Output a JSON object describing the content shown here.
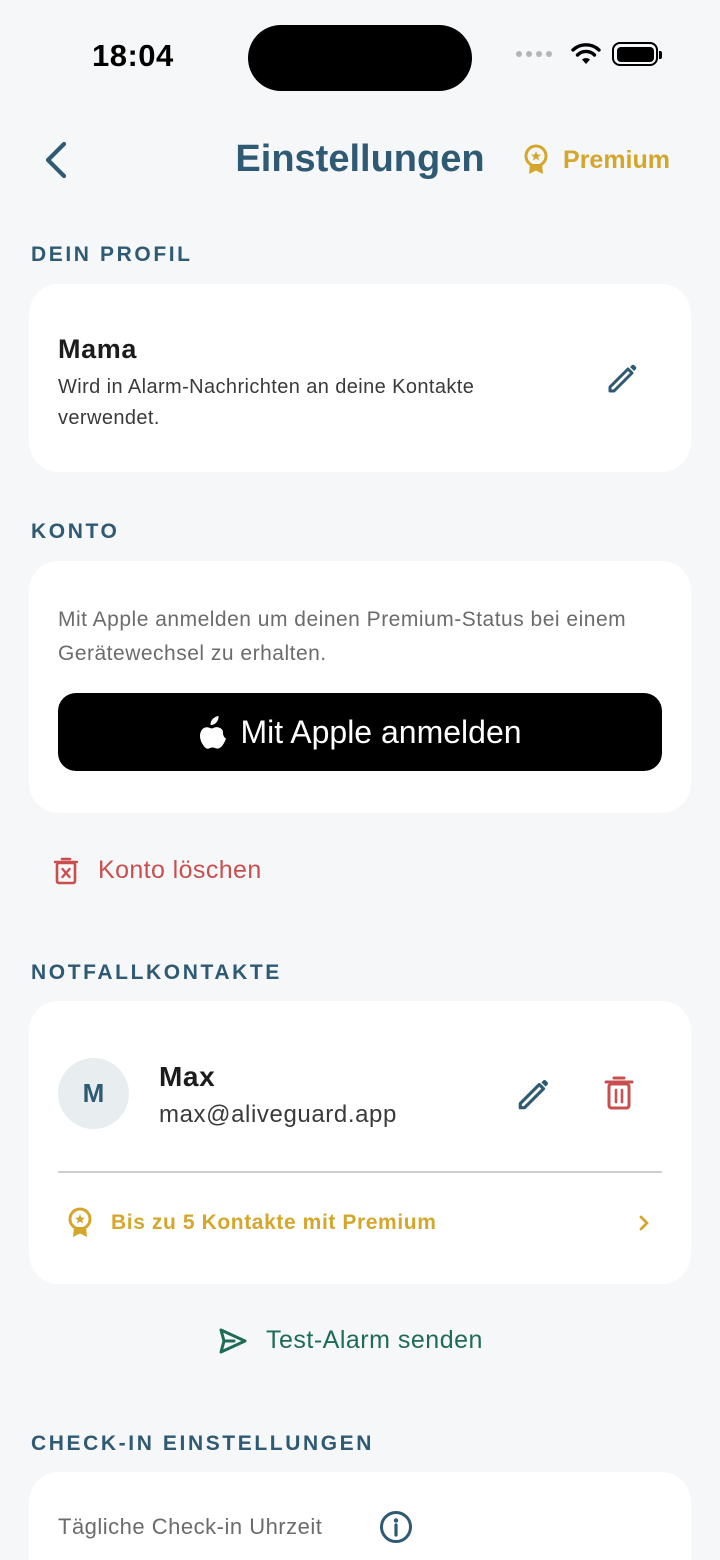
{
  "status_bar": {
    "time": "18:04"
  },
  "header": {
    "title": "Einstellungen",
    "premium_label": "Premium"
  },
  "profile": {
    "section_title": "DEIN PROFIL",
    "name": "Mama",
    "description": "Wird in Alarm-Nachrichten an deine Kontakte verwendet."
  },
  "account": {
    "section_title": "KONTO",
    "description": "Mit Apple anmelden um deinen Premium-Status bei einem Gerätewechsel zu erhalten.",
    "apple_button_label": "Mit Apple anmelden",
    "delete_label": "Konto löschen"
  },
  "contacts": {
    "section_title": "NOTFALLKONTAKTE",
    "items": [
      {
        "initial": "M",
        "name": "Max",
        "email": "max@aliveguard.app"
      }
    ],
    "premium_upsell": "Bis zu 5 Kontakte mit Premium",
    "test_alarm_label": "Test-Alarm senden"
  },
  "checkin": {
    "section_title": "CHECK-IN EINSTELLUNGEN",
    "daily_time_label": "Tägliche Check-in Uhrzeit"
  },
  "colors": {
    "accent": "#2f5a73",
    "premium": "#d4a72c",
    "danger": "#c94f4f",
    "success": "#1e6b57",
    "background": "#f6f7f9"
  },
  "icons": [
    "chevron-left-icon",
    "award-icon",
    "pencil-icon",
    "apple-logo-icon",
    "trash-icon",
    "send-icon",
    "chevron-right-icon",
    "info-icon",
    "wifi-icon",
    "battery-icon"
  ]
}
